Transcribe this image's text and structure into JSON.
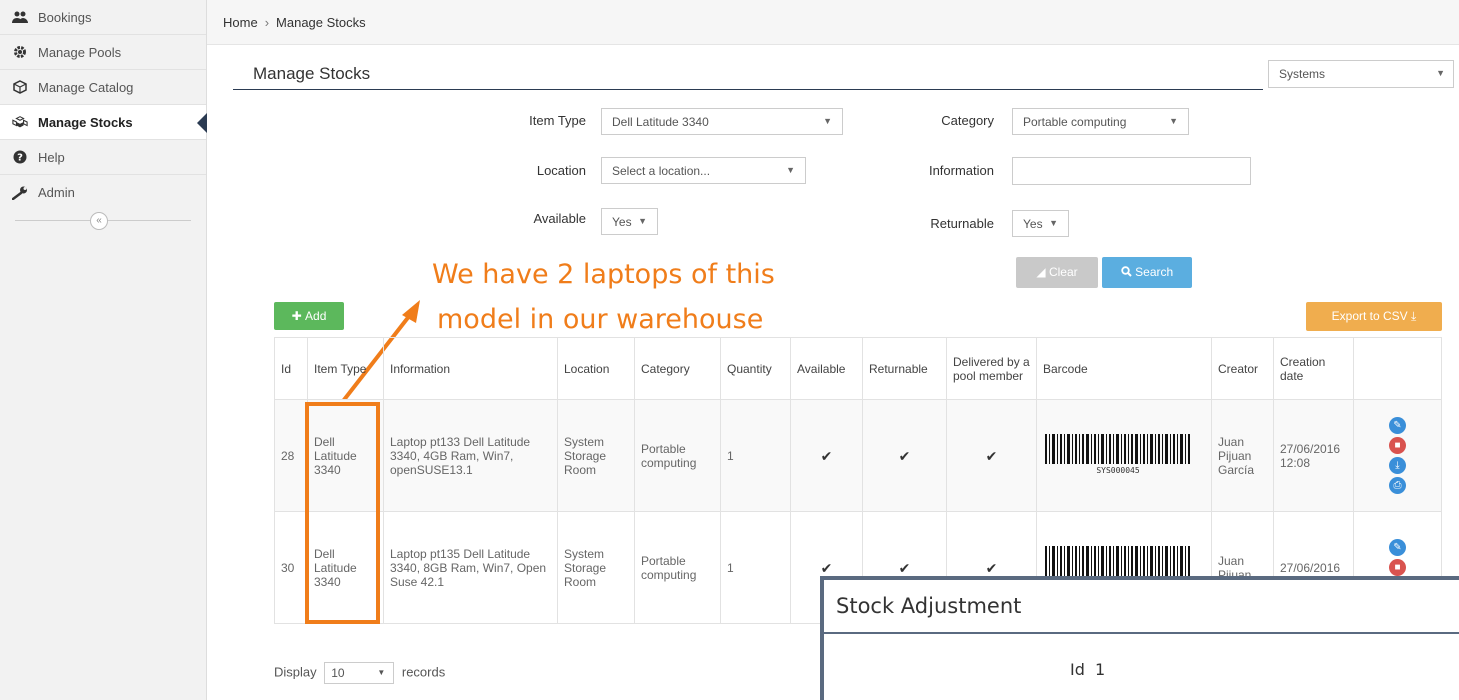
{
  "sidebar": {
    "items": [
      {
        "label": "Bookings",
        "icon": "users-icon"
      },
      {
        "label": "Manage Pools",
        "icon": "gear-icon"
      },
      {
        "label": "Manage Catalog",
        "icon": "cube-icon"
      },
      {
        "label": "Manage Stocks",
        "icon": "cubes-icon"
      },
      {
        "label": "Help",
        "icon": "question-icon"
      },
      {
        "label": "Admin",
        "icon": "wrench-icon"
      }
    ],
    "collapse_glyph": "«"
  },
  "breadcrumb": {
    "home": "Home",
    "separator": "›",
    "current": "Manage Stocks"
  },
  "page": {
    "title": "Manage Stocks",
    "systems_select": "Systems"
  },
  "filters": {
    "item_type_label": "Item Type",
    "item_type_value": "Dell Latitude 3340",
    "category_label": "Category",
    "category_value": "Portable computing",
    "location_label": "Location",
    "location_placeholder": "Select a location...",
    "information_label": "Information",
    "information_value": "",
    "available_label": "Available",
    "available_value": "Yes",
    "returnable_label": "Returnable",
    "returnable_value": "Yes",
    "clear_label": "Clear",
    "search_label": "Search"
  },
  "actions": {
    "add_label": "Add",
    "export_label": "Export to CSV"
  },
  "annotation": {
    "line1": "We have 2 laptops of this",
    "line2": "model in our warehouse",
    "color": "#f07d1a"
  },
  "table": {
    "headers": [
      "Id",
      "Item Type",
      "Information",
      "Location",
      "Category",
      "Quantity",
      "Available",
      "Returnable",
      "Delivered by a pool member",
      "Barcode",
      "Creator",
      "Creation date",
      ""
    ],
    "rows": [
      {
        "id": "28",
        "item_type": "Dell Latitude 3340",
        "information": "Laptop pt133 Dell Latitude 3340, 4GB Ram, Win7, openSUSE13.1",
        "location": "System Storage Room",
        "category": "Portable computing",
        "quantity": "1",
        "barcode_text": "SYS000045",
        "creator": "Juan Pijuan García",
        "creation_date": "27/06/2016 12:08"
      },
      {
        "id": "30",
        "item_type": "Dell Latitude 3340",
        "information": "Laptop pt135 Dell Latitude 3340, 8GB Ram, Win7, Open Suse 42.1",
        "location": "System Storage Room",
        "category": "Portable computing",
        "quantity": "1",
        "barcode_text": "",
        "creator": "Juan Pijuan",
        "creation_date": "27/06/2016"
      }
    ]
  },
  "pagination": {
    "display_label": "Display",
    "page_size": "10",
    "records_label": "records"
  },
  "modal": {
    "title": "Stock Adjustment",
    "id_label": "Id",
    "id_value": "1"
  }
}
